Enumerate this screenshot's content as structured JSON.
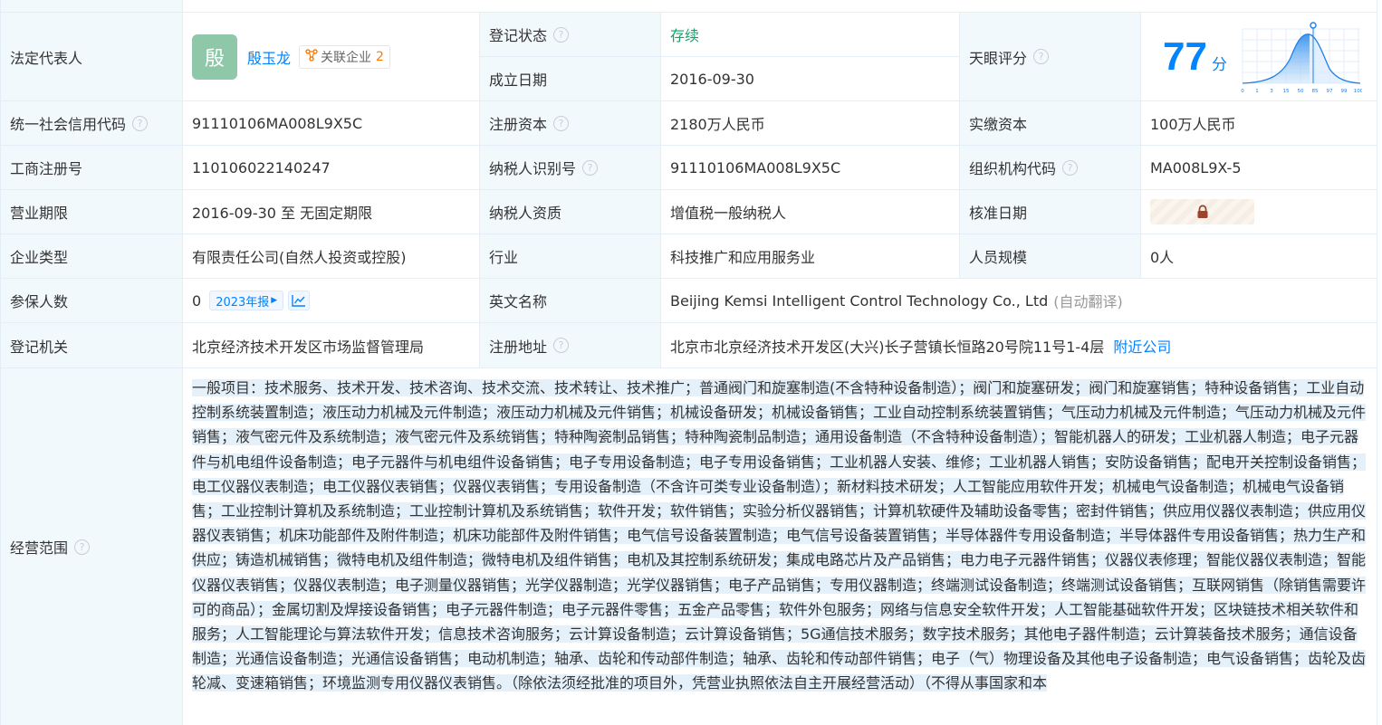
{
  "rows": {
    "legal_rep": {
      "label": "法定代表人",
      "avatar_char": "殷",
      "name": "殷玉龙",
      "related_label": "关联企业",
      "related_count": "2"
    },
    "reg_status": {
      "label": "登记状态",
      "value": "存续"
    },
    "found_date": {
      "label": "成立日期",
      "value": "2016-09-30"
    },
    "tianyan": {
      "label": "天眼评分",
      "score": "77",
      "unit": "分",
      "scale": [
        "0",
        "1",
        "3",
        "15",
        "50",
        "85",
        "97",
        "99",
        "100"
      ]
    },
    "credit_code": {
      "label": "统一社会信用代码",
      "value": "91110106MA008L9X5C"
    },
    "reg_capital": {
      "label": "注册资本",
      "value": "2180万人民币"
    },
    "paid_capital": {
      "label": "实缴资本",
      "value": "100万人民币"
    },
    "biz_reg_no": {
      "label": "工商注册号",
      "value": "110106022140247"
    },
    "taxpayer_id": {
      "label": "纳税人识别号",
      "value": "91110106MA008L9X5C"
    },
    "org_code": {
      "label": "组织机构代码",
      "value": "MA008L9X-5"
    },
    "biz_term": {
      "label": "营业期限",
      "value": "2016-09-30 至 无固定期限"
    },
    "taxpayer_qual": {
      "label": "纳税人资质",
      "value": "增值税一般纳税人"
    },
    "approve_date": {
      "label": "核准日期"
    },
    "company_type": {
      "label": "企业类型",
      "value": "有限责任公司(自然人投资或控股)"
    },
    "industry": {
      "label": "行业",
      "value": "科技推广和应用服务业"
    },
    "staff_size": {
      "label": "人员规模",
      "value": "0人"
    },
    "insured": {
      "label": "参保人数",
      "value": "0",
      "year_btn": "2023年报"
    },
    "english_name": {
      "label": "英文名称",
      "value": "Beijing Kemsi Intelligent Control Technology Co., Ltd",
      "note": "(自动翻译)"
    },
    "reg_authority": {
      "label": "登记机关",
      "value": "北京经济技术开发区市场监督管理局"
    },
    "reg_address": {
      "label": "注册地址",
      "value": "北京市北京经济技术开发区(大兴)长子营镇长恒路20号院11号1-4层",
      "nearby": "附近公司"
    },
    "scope": {
      "label": "经营范围",
      "value": "一般项目：技术服务、技术开发、技术咨询、技术交流、技术转让、技术推广；普通阀门和旋塞制造(不含特种设备制造）；阀门和旋塞研发；阀门和旋塞销售；特种设备销售；工业自动控制系统装置制造；液压动力机械及元件制造；液压动力机械及元件销售；机械设备研发；机械设备销售；工业自动控制系统装置销售；气压动力机械及元件制造；气压动力机械及元件销售；液气密元件及系统制造；液气密元件及系统销售；特种陶瓷制品销售；特种陶瓷制品制造；通用设备制造（不含特种设备制造）；智能机器人的研发；工业机器人制造；电子元器件与机电组件设备制造；电子元器件与机电组件设备销售；电子专用设备制造；电子专用设备销售；工业机器人安装、维修；工业机器人销售；安防设备销售；配电开关控制设备销售；电工仪器仪表制造；电工仪器仪表销售；仪器仪表销售；专用设备制造（不含许可类专业设备制造）；新材料技术研发；人工智能应用软件开发；机械电气设备制造；机械电气设备销售；工业控制计算机及系统制造；工业控制计算机及系统销售；软件开发；软件销售；实验分析仪器销售；计算机软硬件及辅助设备零售；密封件销售；供应用仪器仪表制造；供应用仪器仪表销售；机床功能部件及附件制造；机床功能部件及附件销售；电气信号设备装置制造；电气信号设备装置销售；半导体器件专用设备制造；半导体器件专用设备销售；热力生产和供应；铸造机械销售；微特电机及组件制造；微特电机及组件销售；电机及其控制系统研发；集成电路芯片及产品销售；电力电子元器件销售；仪器仪表修理；智能仪器仪表制造；智能仪器仪表销售；仪器仪表制造；电子测量仪器销售；光学仪器制造；光学仪器销售；电子产品销售；专用仪器制造；终端测试设备制造；终端测试设备销售；互联网销售（除销售需要许可的商品）；金属切割及焊接设备销售；电子元器件制造；电子元器件零售；五金产品零售；软件外包服务；网络与信息安全软件开发；人工智能基础软件开发；区块链技术相关软件和服务；人工智能理论与算法软件开发；信息技术咨询服务；云计算设备制造；云计算设备销售；5G通信技术服务；数字技术服务；其他电子器件制造；云计算装备技术服务；通信设备制造；光通信设备制造；光通信设备销售；电动机制造；轴承、齿轮和传动部件制造；轴承、齿轮和传动部件销售；电子（气）物理设备及其他电子设备制造；电气设备销售；齿轮及齿轮减、变速箱销售；环境监测专用仪器仪表销售。（除依法须经批准的项目外，凭营业执照依法自主开展经营活动）（不得从事国家和本"
    }
  },
  "colors": {
    "label_bg": "#f2f9fc",
    "link": "#0084ff",
    "status_green": "#12a36b",
    "border": "#e4eef6",
    "selection": "#e4f1fb"
  }
}
